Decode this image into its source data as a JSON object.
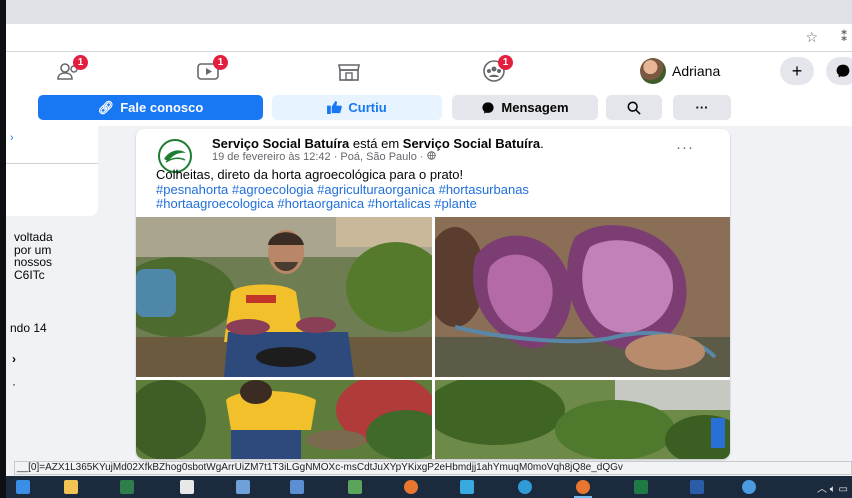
{
  "browser": {
    "bookmark_icon": "star-icon",
    "extension_icon": "puzzle-icon"
  },
  "nav": {
    "friends_badge": "1",
    "watch_badge": "1",
    "groups_badge": "1",
    "profile_name": "Adriana",
    "create_label": "+"
  },
  "actions": {
    "contact_label": "Fale conosco",
    "liked_label": "Curtiu",
    "message_label": "Mensagem",
    "more_label": "···"
  },
  "left": {
    "chevron": "›",
    "intro_lines": [
      "voltada",
      "por um",
      "nossos",
      "C6ITc"
    ],
    "founded": "ndo 14",
    "mark_a": "›",
    "mark_b": "·"
  },
  "post": {
    "page_name": "Serviço Social Batuíra",
    "is_in": "está em",
    "place_name": "Serviço Social Batuíra",
    "period": ".",
    "meta": "19 de fevereiro às 12:42 · Poá, São Paulo · ",
    "text": "Colheitas, direto da horta agroecológica para o prato!",
    "hashtags_line1": "#pesnahorta #agroecologia #agriculturaorganica #hortasurbanas",
    "hashtags_line2": "#hortaagroecologica #hortaorganica #hortalicas #plante",
    "more": "···"
  },
  "status_url": "__[0]=AZX1L365KYujMd02XfkBZhog0sbotWgArrUiZM7t1T3iLGgNMOXc-msCdtJuXYpYKixgP2eHbmdjj1ahYmuqM0moVqh8jQ8e_dQGv",
  "colors": {
    "facebook_blue": "#1877f2",
    "badge_red": "#e41e3f",
    "link_blue": "#216fdb"
  }
}
